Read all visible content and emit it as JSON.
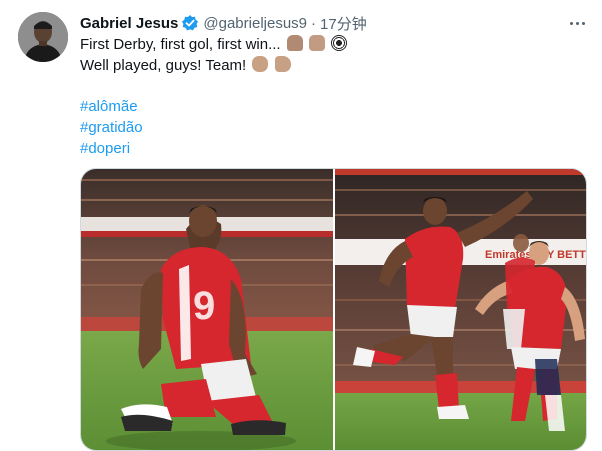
{
  "author": {
    "name": "Gabriel Jesus",
    "handle": "@gabrieljesus9",
    "separator": "·",
    "time": "17分钟"
  },
  "icons": {
    "verified": "verified-badge-icon",
    "more": "more-options-icon"
  },
  "tweet": {
    "line1_text": "First Derby, first gol, first win...",
    "line2_text": "Well played, guys! Team!",
    "hashtags": [
      "#alômãe",
      "#gratidão",
      "#doperi"
    ]
  },
  "media": {
    "left_photo": {
      "board_text": ""
    },
    "right_photo": {
      "board_text": "Emirates FLY BETTER"
    }
  },
  "colors": {
    "link": "#1d9bf0",
    "verified": "#1d9bf0",
    "kit_red": "#d6262e",
    "pitch": "#6b9b3a"
  }
}
